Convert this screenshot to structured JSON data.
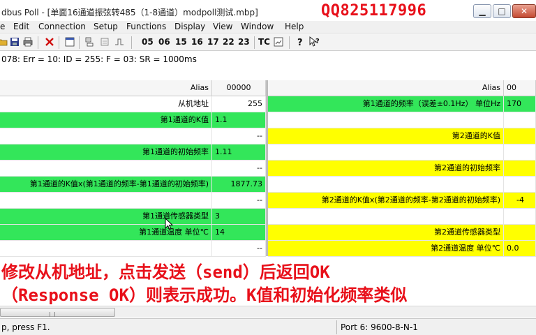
{
  "window": {
    "title": "dbus Poll - [单面16通道振弦转485（1-8通道）modpoll测试.mbp]",
    "overlay_qq": "QQ825117996"
  },
  "menu": [
    "e",
    "Edit",
    "Connection",
    "Setup",
    "Functions",
    "Display",
    "View",
    "Window",
    "Help"
  ],
  "toolbar": {
    "codes": [
      "05",
      "06",
      "15",
      "16",
      "17",
      "22",
      "23",
      "TC"
    ],
    "icons": [
      "folder-icon",
      "save-icon",
      "print-icon",
      "delete-icon",
      "read-icon",
      "write-icon",
      "pulse-icon",
      "window-icon",
      "help-icon",
      "context-help-icon"
    ]
  },
  "status_line": "078: Err = 10: ID = 255: F = 03: SR = 1000ms",
  "grid": {
    "left": {
      "header_alias": "Alias",
      "header_value": "00000",
      "rows": [
        {
          "alias": "从机地址",
          "value": "255",
          "color": "white"
        },
        {
          "alias": "第1通道的K值",
          "value": "1.1",
          "color": "green"
        },
        {
          "alias": "",
          "value": "--",
          "color": "white"
        },
        {
          "alias": "第1通道的初始频率",
          "value": "1.11",
          "color": "green"
        },
        {
          "alias": "",
          "value": "--",
          "color": "white"
        },
        {
          "alias": "第1通道的K值x(第1通道的频率-第1通道的初始频率)",
          "value": "1877.73",
          "color": "green"
        },
        {
          "alias": "",
          "value": "--",
          "color": "white"
        },
        {
          "alias": "第1通道传感器类型",
          "value": "3",
          "color": "green"
        },
        {
          "alias": "第1通道温度  单位℃",
          "value": "14",
          "color": "green"
        },
        {
          "alias": "",
          "value": "--",
          "color": "white"
        }
      ]
    },
    "right": {
      "header_alias": "Alias",
      "header_value": "00",
      "rows": [
        {
          "alias": "第1通道的频率（误差±0.1Hz）  单位Hz",
          "value": "170",
          "color": "green"
        },
        {
          "alias": "",
          "value": "",
          "color": "white"
        },
        {
          "alias": "第2通道的K值",
          "value": "",
          "color": "yellow"
        },
        {
          "alias": "",
          "value": "",
          "color": "white"
        },
        {
          "alias": "第2通道的初始频率",
          "value": "",
          "color": "yellow"
        },
        {
          "alias": "",
          "value": "",
          "color": "white"
        },
        {
          "alias": "第2通道的K值x(第2通道的频率-第2通道的初始频率)",
          "value": "-4",
          "color": "yellow"
        },
        {
          "alias": "",
          "value": "",
          "color": "white"
        },
        {
          "alias": "第2通道传感器类型",
          "value": "",
          "color": "yellow"
        },
        {
          "alias": "第2通道温度  单位℃",
          "value": "0.0",
          "color": "yellow"
        }
      ]
    }
  },
  "subtitles": [
    "修改从机地址，点击发送（send）后返回OK",
    "（Response OK）则表示成功。K值和初始化频率类似"
  ],
  "statusbar": {
    "help": "p, press F1.",
    "port": "Port 6: 9600-8-N-1"
  },
  "colors": {
    "green": "#33e65a",
    "yellow": "#ffff00",
    "subtitle_red": "#e8101a"
  }
}
